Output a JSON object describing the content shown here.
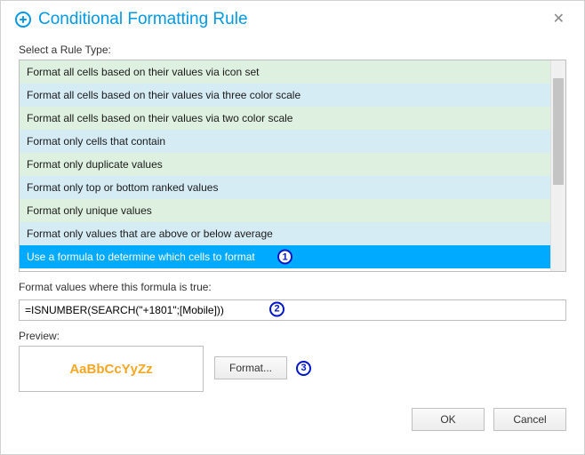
{
  "dialog": {
    "title": "Conditional Formatting Rule",
    "close_aria": "Close"
  },
  "labels": {
    "select_rule_type": "Select a Rule Type:",
    "formula_label": "Format values where this formula is true:",
    "preview": "Preview:"
  },
  "rule_types": [
    "Format all cells based on their values via icon set",
    "Format all cells based on their values via three color scale",
    "Format all cells based on their values via two color scale",
    "Format only cells that contain",
    "Format only duplicate values",
    "Format only top or bottom ranked values",
    "Format only unique values",
    "Format only values that are above or below average",
    "Use a formula to determine which cells to format"
  ],
  "selected_rule_index": 8,
  "formula_value": "=ISNUMBER(SEARCH(\"+1801\";[Mobile]))",
  "preview_sample": "AaBbCcYyZz",
  "buttons": {
    "format": "Format...",
    "ok": "OK",
    "cancel": "Cancel"
  },
  "markers": {
    "one": "1",
    "two": "2",
    "three": "3"
  },
  "colors": {
    "accent": "#0099e6",
    "preview_text": "#f5a623",
    "marker": "#0015c7"
  }
}
